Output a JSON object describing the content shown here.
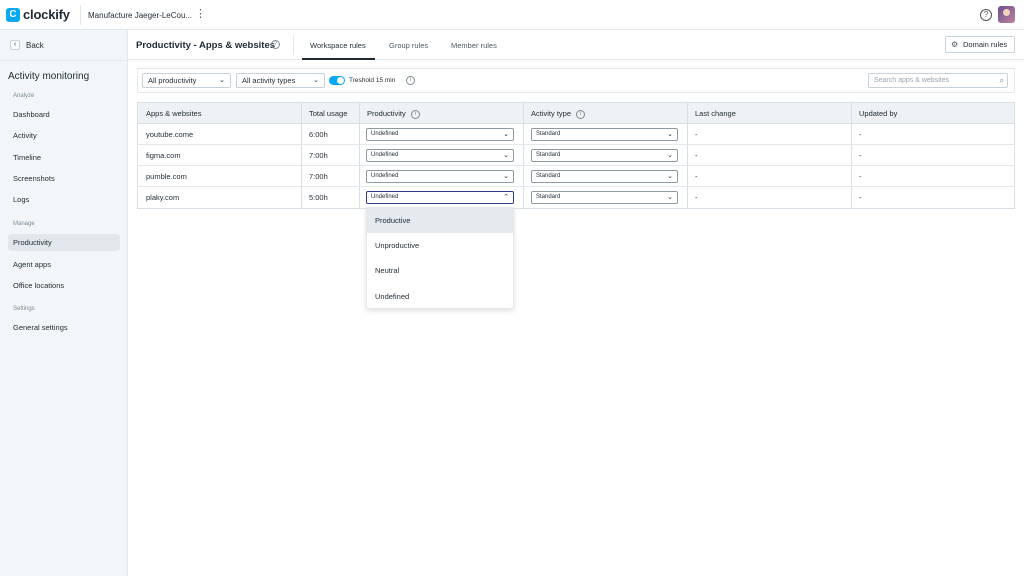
{
  "topbar": {
    "logo_mark": "C",
    "logo_text": "clockify",
    "workspace_name": "Manufacture Jaeger-LeCou...",
    "kebab_glyph": "⋮",
    "help_glyph": "?"
  },
  "sidebar": {
    "back_label": "Back",
    "back_glyph": "‹",
    "title": "Activity monitoring",
    "sections": {
      "analyze": "Analyze",
      "manage": "Manage",
      "settings": "Settings"
    },
    "items": [
      {
        "label": "Dashboard",
        "active": false
      },
      {
        "label": "Activity",
        "active": false
      },
      {
        "label": "Timeline",
        "active": false
      },
      {
        "label": "Screenshots",
        "active": false
      },
      {
        "label": "Logs",
        "active": false
      },
      {
        "label": "Productivity",
        "active": true
      },
      {
        "label": "Agent apps",
        "active": false
      },
      {
        "label": "Office locations",
        "active": false
      },
      {
        "label": "General settings",
        "active": false
      }
    ]
  },
  "header": {
    "title": "Productivity - Apps & websites",
    "tabs": [
      {
        "label": "Workspace rules",
        "active": true
      },
      {
        "label": "Group rules",
        "active": false
      },
      {
        "label": "Member rules",
        "active": false
      }
    ],
    "domain_rules_label": "Domain rules"
  },
  "filters": {
    "productivity": "All productivity",
    "activity_types": "All activity types",
    "threshold_label": "Treshold 15 min",
    "threshold_enabled": true,
    "search_placeholder": "Search apps & websites"
  },
  "table": {
    "headers": [
      "Apps & websites",
      "Total usage",
      "Productivity",
      "Activity type",
      "Last change",
      "Updated by"
    ],
    "rows": [
      {
        "app": "youtube.come",
        "usage": "6:00h",
        "productivity": "Undefined",
        "activity_type": "Standard",
        "last_change": "-",
        "updated_by": "-"
      },
      {
        "app": "figma.com",
        "usage": "7:00h",
        "productivity": "Undefined",
        "activity_type": "Standard",
        "last_change": "-",
        "updated_by": "-"
      },
      {
        "app": "pumble.com",
        "usage": "7:00h",
        "productivity": "Undefined",
        "activity_type": "Standard",
        "last_change": "-",
        "updated_by": "-"
      },
      {
        "app": "plaky.com",
        "usage": "5:00h",
        "productivity": "Undefined",
        "activity_type": "Standard",
        "last_change": "-",
        "updated_by": "-"
      }
    ]
  },
  "dropdown": {
    "options": [
      "Productive",
      "Unproductive",
      "Neutral",
      "Undefined"
    ],
    "highlighted": "Productive"
  },
  "colors": {
    "accent": "#03a9f4",
    "focus_border": "#2f3b8f"
  }
}
